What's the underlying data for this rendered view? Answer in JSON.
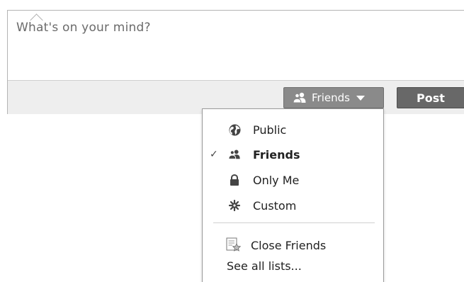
{
  "composer": {
    "placeholder": "What's on your mind?"
  },
  "toolbar": {
    "audience_label": "Friends",
    "audience_icon": "friends-icon",
    "post_label": "Post"
  },
  "audience_menu": {
    "items": [
      {
        "label": "Public",
        "icon": "globe-icon",
        "selected": false
      },
      {
        "label": "Friends",
        "icon": "friends-icon",
        "selected": true
      },
      {
        "label": "Only Me",
        "icon": "lock-icon",
        "selected": false
      },
      {
        "label": "Custom",
        "icon": "gear-icon",
        "selected": false
      }
    ],
    "lists": [
      {
        "label": "Close Friends",
        "icon": "close-friends-star-icon"
      }
    ],
    "see_all_label": "See all lists...",
    "check_glyph": "✓"
  },
  "colors": {
    "audience_button_bg": "#8a8a8a",
    "post_button_bg": "#686868",
    "footer_bg": "#eeeeee",
    "border": "#b4b4b4"
  }
}
